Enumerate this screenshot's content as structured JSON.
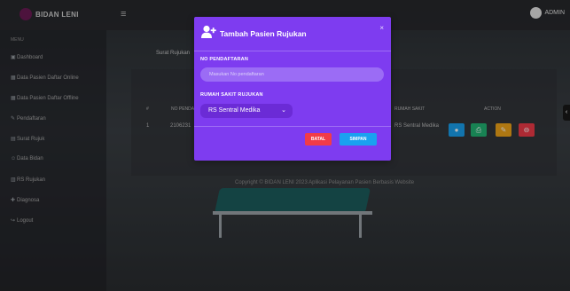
{
  "topbar": {
    "brand": "BIDAN LENI",
    "menu_icon": "hamburger-icon",
    "user_label": "ADMIN"
  },
  "sidebar": {
    "heading": "MENU",
    "items": [
      {
        "label": "Dashboard",
        "icon": "tachometer-icon"
      },
      {
        "label": "Data Pasien Daftar Online",
        "icon": "table-icon"
      },
      {
        "label": "Data Pasien Daftar Offline",
        "icon": "table-icon"
      },
      {
        "label": "Pendaftaran",
        "icon": "edit-icon"
      },
      {
        "label": "Surat Rujuk",
        "icon": "file-icon"
      },
      {
        "label": "Data Bidan",
        "icon": "user-icon"
      },
      {
        "label": "RS Rujukan",
        "icon": "hospital-icon"
      },
      {
        "label": "Diagnosa",
        "icon": "stethoscope-icon"
      },
      {
        "label": "Logout",
        "icon": "logout-icon"
      }
    ]
  },
  "page": {
    "subtitle": "Surat Rujukan",
    "columns": [
      "#",
      "NO PENDAFTARAN",
      "RUMAH SAKIT",
      "ACTION"
    ],
    "row": {
      "no": "1",
      "id": "2106231",
      "rs": "RS Sentral Medika"
    },
    "footer": "Copyright © BIDAN LENI 2023 Aplikasi Pelayanan Pasien Berbasis Website"
  },
  "modal": {
    "title": "Tambah Pasien Rujukan",
    "close_label": "×",
    "field1_label": "NO PENDAFTARAN",
    "field1_placeholder": "Masukan No pendaftaran",
    "field2_label": "RUMAH SAKIT RUJUKAN",
    "field2_value": "RS Sentral Medika",
    "cancel_label": "BATAL",
    "save_label": "SIMPAN"
  },
  "colors": {
    "modal_bg": "#7e3cf0",
    "cancel": "#f23b48",
    "save": "#1aa1f0"
  }
}
